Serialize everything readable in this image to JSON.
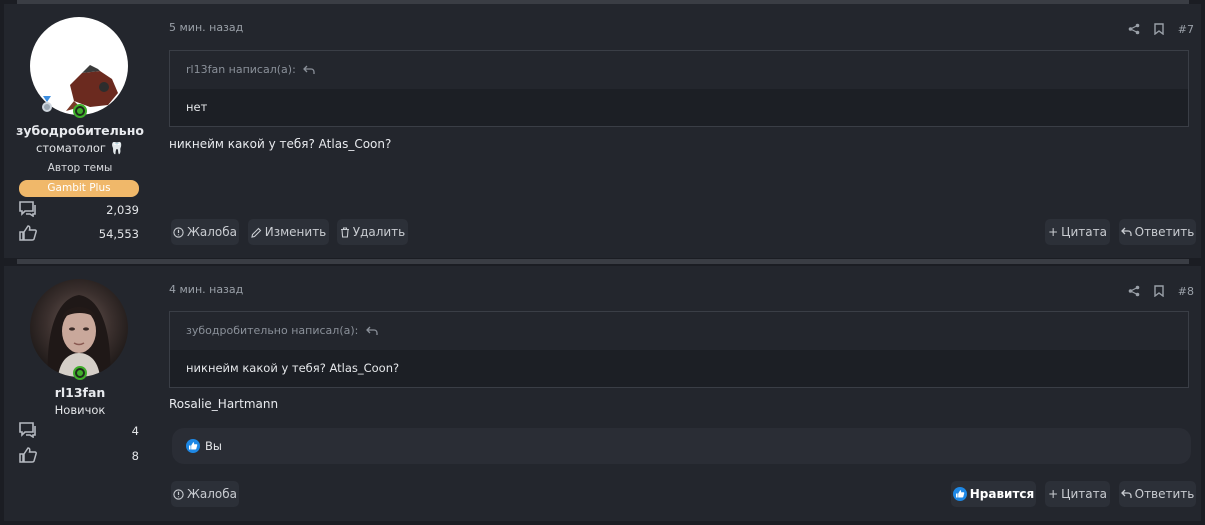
{
  "posts": [
    {
      "username": "зубодробительно",
      "user_title": "стоматолог 🦷",
      "author_tag": "Автор темы",
      "banner": "Gambit Plus",
      "stats": {
        "messages": "2,039",
        "reactions": "54,553"
      },
      "time": "5 мин. назад",
      "post_number": "#7",
      "quote": {
        "author": "rl13fan написал(а):",
        "text": "нет"
      },
      "message": "никнейм какой у тебя? Atlas_Coon?",
      "actions": {
        "report": "Жалоба",
        "edit": "Изменить",
        "delete": "Удалить",
        "quote": "Цитата",
        "reply": "Ответить"
      }
    },
    {
      "username": "rl13fan",
      "user_title": "Новичок",
      "stats": {
        "messages": "4",
        "reactions": "8"
      },
      "time": "4 мин. назад",
      "post_number": "#8",
      "quote": {
        "author": "зубодробительно написал(а):",
        "text": "никнейм какой у тебя? Atlas_Coon?"
      },
      "message": "Rosalie_Hartmann",
      "likes_text": "Вы",
      "actions": {
        "report": "Жалоба",
        "like": "Нравится",
        "quote": "Цитата",
        "reply": "Ответить"
      }
    }
  ],
  "icons": {
    "share": "share-icon",
    "bookmark": "bookmark-icon",
    "reply_arrow": "reply-arrow-icon",
    "messages": "messages-icon",
    "thumbs_up": "thumbs-up-icon",
    "status": "online-status-icon"
  },
  "colors": {
    "banner": "#f0b86a",
    "online": "#3fae2a",
    "like": "#1e88e5",
    "background": "#23262d"
  }
}
